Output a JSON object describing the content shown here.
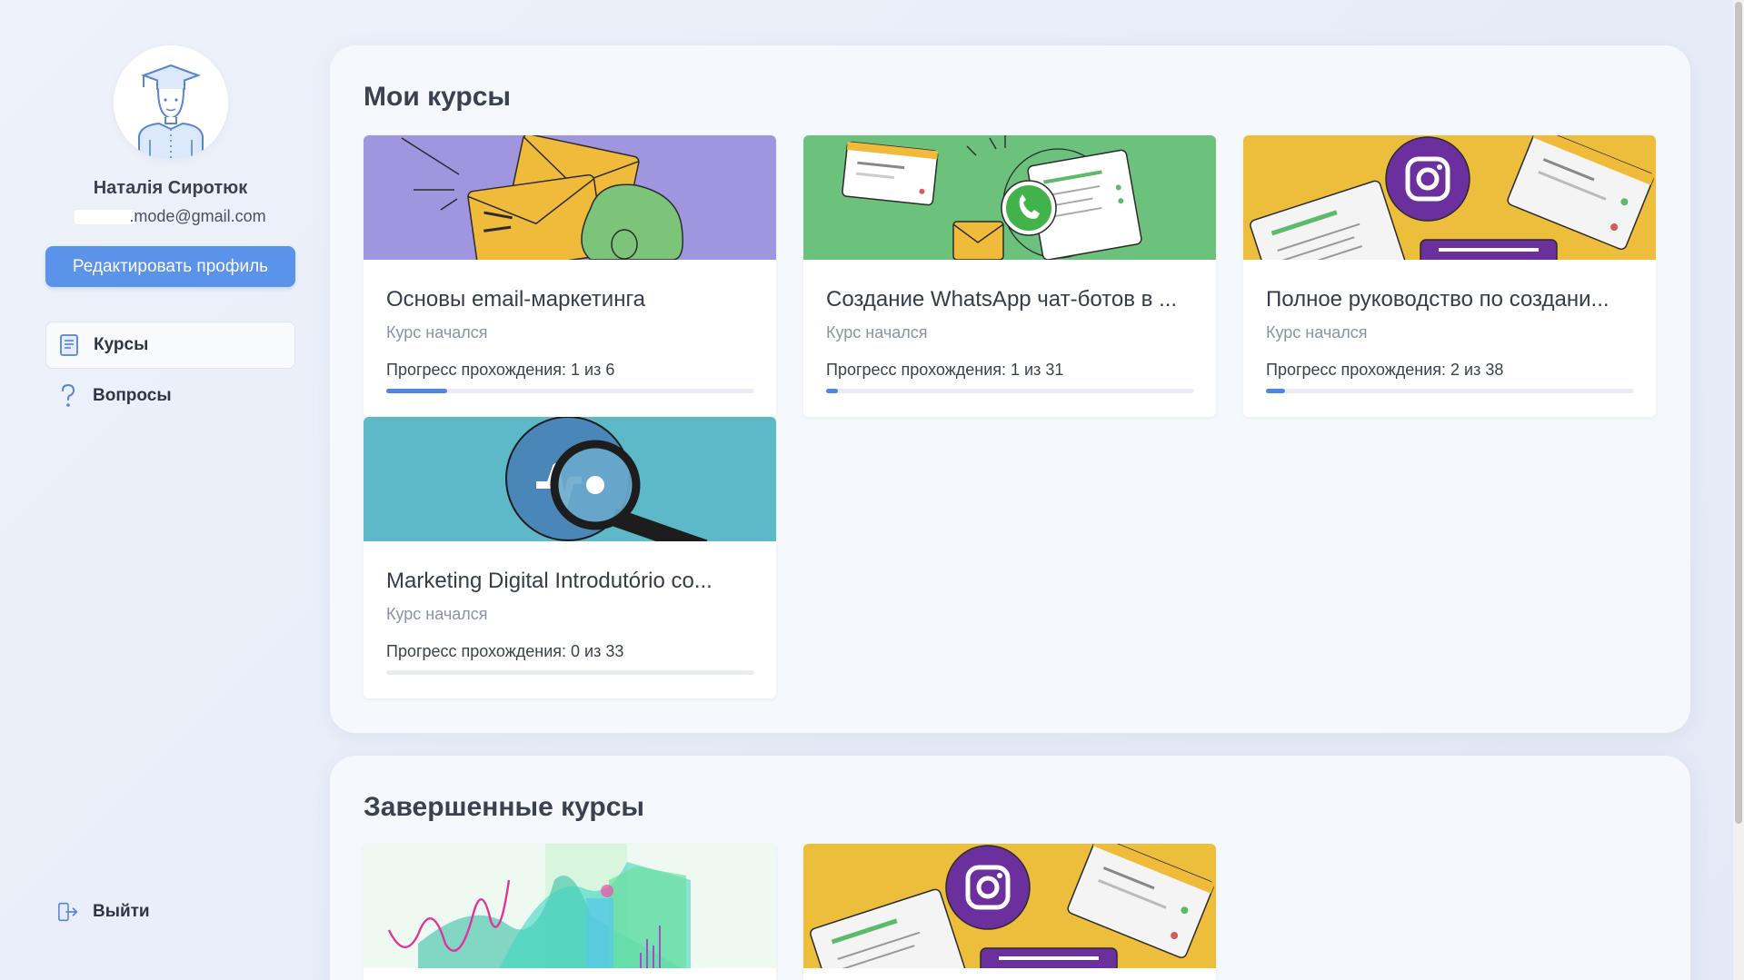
{
  "user": {
    "name": "Наталія Сиротюк",
    "email": ".mode@gmail.com",
    "edit_profile_label": "Редактировать профиль"
  },
  "nav": {
    "courses_label": "Курсы",
    "questions_label": "Вопросы",
    "logout_label": "Выйти"
  },
  "my_courses": {
    "title": "Мои курсы",
    "cards": [
      {
        "title": "Основы email-маркетинга",
        "status": "Курс начался",
        "progress_text": "Прогресс прохождения: 1 из 6",
        "done": 1,
        "total": 6,
        "banner_color": "#a095df"
      },
      {
        "title": "Создание WhatsApp чат-ботов в ...",
        "status": "Курс начался",
        "progress_text": "Прогресс прохождения: 1 из 31",
        "done": 1,
        "total": 31,
        "banner_color": "#6cc17c"
      },
      {
        "title": "Полное руководство по создани...",
        "status": "Курс начался",
        "progress_text": "Прогресс прохождения: 2 из 38",
        "done": 2,
        "total": 38,
        "banner_color": "#edbd3c"
      },
      {
        "title": "Marketing Digital Introdutório co...",
        "status": "Курс начался",
        "progress_text": "Прогресс прохождения: 0 из 33",
        "done": 0,
        "total": 33,
        "banner_color": "#5db8c8"
      }
    ]
  },
  "completed_courses": {
    "title": "Завершенные курсы"
  },
  "colors": {
    "accent": "#5b93ea",
    "progress_fill": "#4f86e4",
    "instagram_purple": "#6b2f9e"
  }
}
